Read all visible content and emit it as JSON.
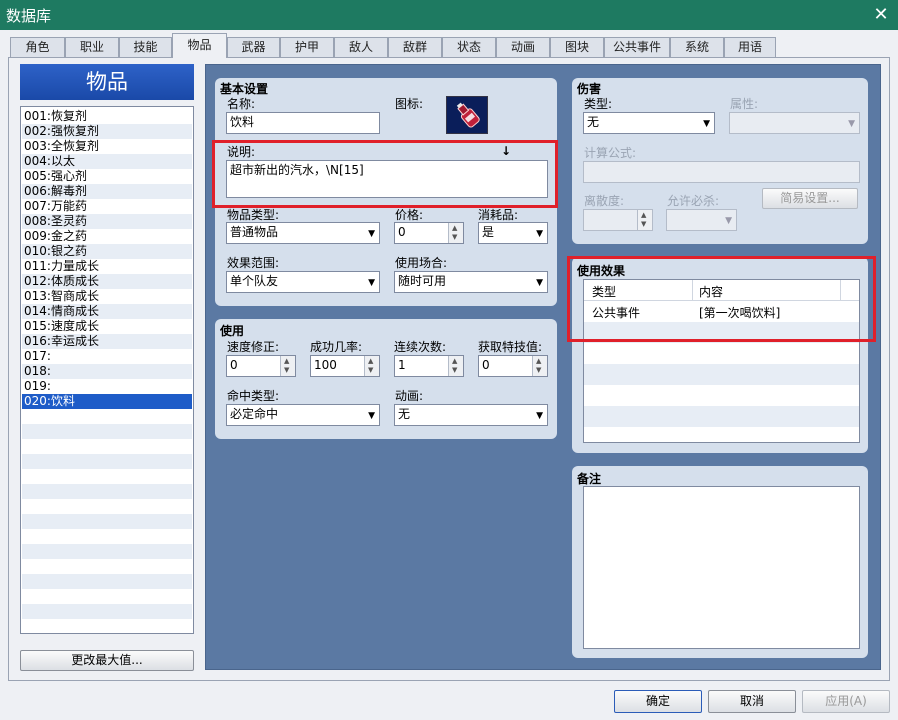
{
  "window": {
    "title": "数据库"
  },
  "tabs": [
    {
      "label": "角色"
    },
    {
      "label": "职业"
    },
    {
      "label": "技能"
    },
    {
      "label": "物品"
    },
    {
      "label": "武器"
    },
    {
      "label": "护甲"
    },
    {
      "label": "敌人"
    },
    {
      "label": "敌群"
    },
    {
      "label": "状态"
    },
    {
      "label": "动画"
    },
    {
      "label": "图块"
    },
    {
      "label": "公共事件"
    },
    {
      "label": "系统"
    },
    {
      "label": "用语"
    }
  ],
  "active_tab": "物品",
  "item_list": {
    "header": "物品",
    "items": [
      "001:恢复剂",
      "002:强恢复剂",
      "003:全恢复剂",
      "004:以太",
      "005:强心剂",
      "006:解毒剂",
      "007:万能药",
      "008:圣灵药",
      "009:金之药",
      "010:银之药",
      "011:力量成长",
      "012:体质成长",
      "013:智商成长",
      "014:情商成长",
      "015:速度成长",
      "016:幸运成长",
      "017:",
      "018:",
      "019:",
      "020:饮料"
    ],
    "selected_index": 19,
    "change_max_button": "更改最大值..."
  },
  "basic": {
    "title": "基本设置",
    "name_label": "名称:",
    "name_value": "饮料",
    "icon_label": "图标:",
    "desc_label": "说明:",
    "desc_value": "超市新出的汽水，\\N[15]",
    "desc_marker": "↓",
    "type_label": "物品类型:",
    "type_value": "普通物品",
    "price_label": "价格:",
    "price_value": "0",
    "consumable_label": "消耗品:",
    "consumable_value": "是",
    "scope_label": "效果范围:",
    "scope_value": "单个队友",
    "occasion_label": "使用场合:",
    "occasion_value": "随时可用"
  },
  "usage": {
    "title": "使用",
    "speed_label": "速度修正:",
    "speed_value": "0",
    "success_label": "成功几率:",
    "success_value": "100",
    "repeat_label": "连续次数:",
    "repeat_value": "1",
    "tp_label": "获取特技值:",
    "tp_value": "0",
    "hit_label": "命中类型:",
    "hit_value": "必定命中",
    "anim_label": "动画:",
    "anim_value": "无"
  },
  "damage": {
    "title": "伤害",
    "type_label": "类型:",
    "type_value": "无",
    "element_label": "属性:",
    "formula_label": "计算公式:",
    "variance_label": "离散度:",
    "critical_label": "允许必杀:",
    "easy_button": "简易设置..."
  },
  "effects": {
    "title": "使用效果",
    "col_type": "类型",
    "col_content": "内容",
    "rows": [
      {
        "type": "公共事件",
        "content": "[第一次喝饮料]"
      }
    ]
  },
  "note": {
    "title": "备注"
  },
  "footer": {
    "ok": "确定",
    "cancel": "取消",
    "apply": "应用(A)"
  },
  "colors": {
    "accent": "#1e5cc8",
    "highlight": "#e0202a",
    "titlebar": "#1e7a61",
    "panel": "#5b79a3"
  }
}
